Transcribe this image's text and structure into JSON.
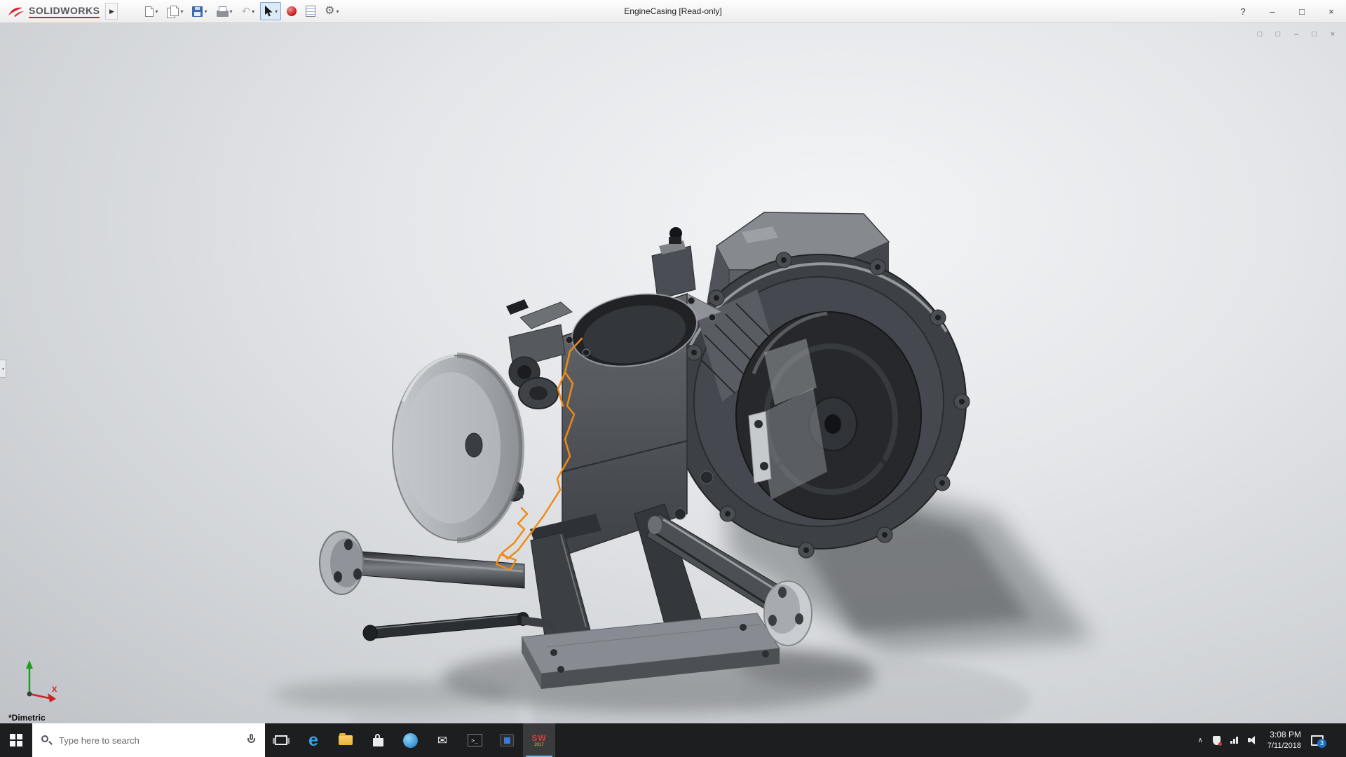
{
  "colors": {
    "sketch_highlight": "#ef8a15",
    "logo_red": "#cf2127",
    "taskbar_active_accent": "#76b9ed"
  },
  "titlebar": {
    "logo_text": "SOLIDWORKS",
    "document_title": "EngineCasing [Read-only]"
  },
  "window_controls": {
    "help": "?",
    "minimize": "–",
    "maximize": "□",
    "close": "×"
  },
  "doc_controls": {
    "icon1": "□",
    "icon2": "□",
    "minimize": "–",
    "restore": "□",
    "close": "×"
  },
  "icons": {
    "flyout": "▶",
    "caret": "▾",
    "undo": "↶",
    "gear": "⚙",
    "mail": "✉",
    "terminal": ">_",
    "chevron_up": "∧",
    "collapse": "◂"
  },
  "viewport": {
    "orientation_label": "*Dimetric",
    "triad_x_label": "X"
  },
  "taskbar": {
    "search_placeholder": "Type here to search",
    "edge_letter": "e",
    "solidworks_text": "SW",
    "solidworks_year": "2017"
  },
  "tray": {
    "time": "3:08 PM",
    "date": "7/11/2018",
    "notification_count": "3"
  }
}
